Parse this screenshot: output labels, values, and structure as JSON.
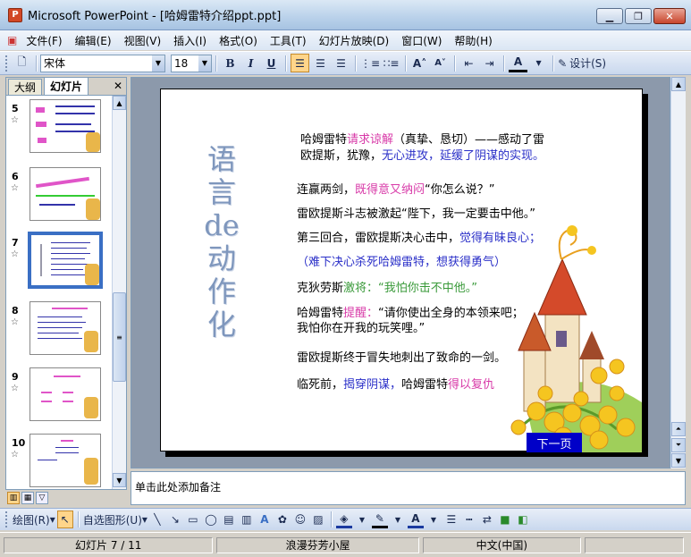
{
  "window": {
    "app_icon": "P",
    "title": "Microsoft PowerPoint - [哈姆雷特介绍ppt.ppt]"
  },
  "menu": [
    "文件(F)",
    "编辑(E)",
    "视图(V)",
    "插入(I)",
    "格式(O)",
    "工具(T)",
    "幻灯片放映(D)",
    "窗口(W)",
    "帮助(H)"
  ],
  "toolbar": {
    "font": "宋体",
    "size": "18",
    "design_label": "设计(S)",
    "bold": "B",
    "italic": "I",
    "underline": "U"
  },
  "left_pane": {
    "tabs": [
      "大纲",
      "幻灯片"
    ],
    "close": "✕",
    "slides": [
      {
        "num": "5",
        "star": "☆"
      },
      {
        "num": "6",
        "star": "☆"
      },
      {
        "num": "7",
        "star": "☆"
      },
      {
        "num": "8",
        "star": "☆"
      },
      {
        "num": "9",
        "star": "☆"
      },
      {
        "num": "10",
        "star": "☆"
      }
    ]
  },
  "slide": {
    "vertical_title": "语言de动作化",
    "next_button": "下一页",
    "line1a": "哈姆雷特",
    "line1b": "请求谅解",
    "line1c": "（真挚、恳切）——感动了雷",
    "line2a": "欧提斯，犹豫，",
    "line2b": "无心进攻，延缓了阴谋的实现。",
    "line3a": "连赢两剑，",
    "line3b": "既得意又纳闷",
    "line3c": "“你怎么说？”",
    "line4": "雷欧提斯斗志被激起“陛下，我一定要击中他。”",
    "line5a": "第三回合，雷欧提斯决心击中，",
    "line5b": "觉得有昧良心；",
    "line6": "（难下决心杀死哈姆雷特，想获得勇气）",
    "line7a": "克狄劳斯",
    "line7b": "激将：“我怕你击不中他。”",
    "line8a": "哈姆雷特",
    "line8b": "提醒：",
    "line8c": "“请你使出全身的本领来吧；",
    "line9": "我怕你在开我的玩笑哩。”",
    "line10": "雷欧提斯终于冒失地刺出了致命的一剑。",
    "line11a": "临死前，",
    "line11b": "揭穿阴谋，",
    "line11c": "哈姆雷特",
    "line11d": "得以复仇"
  },
  "notes": {
    "placeholder": "单击此处添加备注"
  },
  "drawbar": {
    "draw": "绘图(R)",
    "autoshapes": "自选图形(U)"
  },
  "status": {
    "slide": "幻灯片 7 / 11",
    "design": "浪漫芬芳小屋",
    "lang": "中文(中国)"
  },
  "icons": [
    "app-icon",
    "minimize-icon",
    "maximize-icon",
    "close-icon",
    "new-icon",
    "bold-icon",
    "italic-icon",
    "underline-icon",
    "align-left-icon",
    "align-center-icon",
    "align-right-icon",
    "numbering-icon",
    "bullets-icon",
    "increase-font-icon",
    "decrease-font-icon",
    "decrease-indent-icon",
    "increase-indent-icon",
    "font-color-icon",
    "design-icon",
    "select-icon",
    "line-icon",
    "arrow-icon",
    "rectangle-icon",
    "oval-icon",
    "textbox-icon",
    "wordart-icon",
    "clipart-icon",
    "picture-icon",
    "fill-color-icon",
    "line-color-icon",
    "shadow-icon",
    "3d-icon"
  ]
}
